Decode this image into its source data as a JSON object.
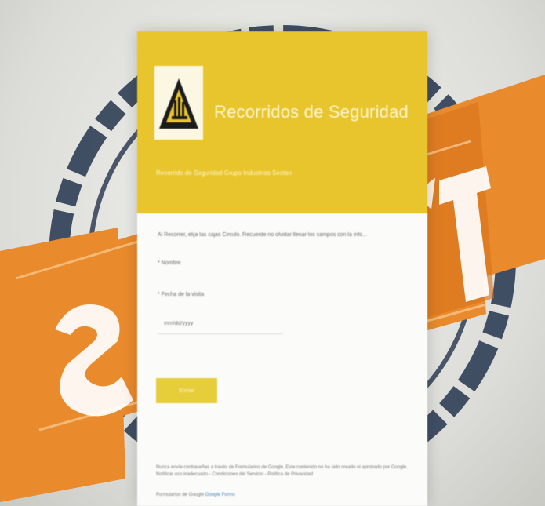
{
  "background": {
    "poster_word": "SAFETY FIRST",
    "icon": "safety-first-stamp-icon",
    "colors": {
      "ring": "#2f3e55",
      "banner": "#e98a2c",
      "banner_dark": "#d9731d"
    }
  },
  "form": {
    "header": {
      "title": "Recorridos de Seguridad",
      "subtitle": "Recorrido de Seguridad Grupo Industrias Sestan",
      "logo_icon": "hazard-triangle-logo-icon",
      "color": "#e8c52c"
    },
    "instructions": "Al Recorrer, elija las cajas Circulo. Recuerde no olvidar llenar los campos con la info...",
    "fields": {
      "name_label": "* Nombre",
      "date_label": "* Fecha de la visita",
      "date_placeholder": "mm/dd/yyyy"
    },
    "submit_label": "Enviar",
    "footer": {
      "text": "Nunca envíe contraseñas a través de Formularios de Google. Este contenido no ha sido creado ni aprobado por Google. Notificar uso inadecuado - Condiciones del Servicio - Política de Privacidad",
      "link_prefix": "Formularios de Google",
      "link_text": "Google Forms"
    }
  }
}
